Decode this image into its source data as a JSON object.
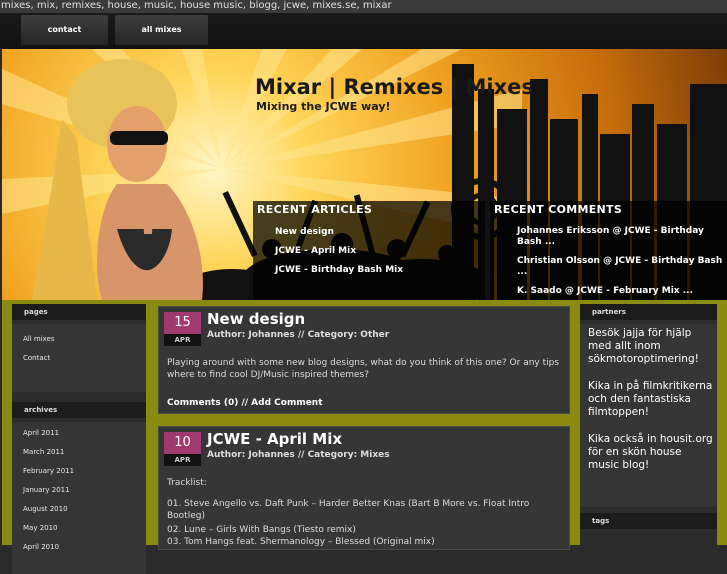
{
  "top_keywords": "mixes, mix, remixes, house, music, house music, blogg, jcwe, mixes.se, mixar",
  "nav": {
    "contact": "contact",
    "all_mixes": "all mixes"
  },
  "header": {
    "title": "Mixar | Remixes | Mixes",
    "subtitle": "Mixing the JCWE way!",
    "recent_articles_heading": "RECENT ARTICLES",
    "recent_articles": [
      "New design",
      "JCWE - April Mix",
      "JCWE - Birthday Bash Mix"
    ],
    "recent_comments_heading": "RECENT COMMENTS",
    "recent_comments": [
      "Johannes Eriksson @ JCWE - Birthday Bash ...",
      "Christian Olsson @ JCWE - Birthday Bash ...",
      "K. Saado @ JCWE - February Mix ..."
    ]
  },
  "sidebar_left": {
    "pages_heading": "pages",
    "pages": [
      "All mixes",
      "Contact"
    ],
    "archives_heading": "archives",
    "archives": [
      "April 2011",
      "March 2011",
      "February 2011",
      "January 2011",
      "August 2010",
      "May 2010",
      "April 2010"
    ]
  },
  "posts": [
    {
      "day": "15",
      "month": "APR",
      "title": "New design",
      "meta": "Author: Johannes  //  Category: Other",
      "body": "Playing around with some new blog designs, what do you think of this one? Or any tips where to find cool DJ/Music inspired themes?",
      "footer": "Comments (0)  //  Add Comment"
    },
    {
      "day": "10",
      "month": "APR",
      "title": "JCWE - April Mix",
      "meta": "Author: Johannes  //  Category: Mixes",
      "intro": "Tracklist:",
      "tracks": [
        "01. Steve Angello vs. Daft Punk – Harder Better Knas (Bart B More vs. Float Intro Bootleg)",
        "02. Lune – Girls With Bangs (Tiesto remix)",
        "03. Tom Hangs feat. Shermanology – Blessed (Original mix)"
      ]
    }
  ],
  "sidebar_right": {
    "partners_heading": "partners",
    "partners": [
      "Besök jajja för hjälp med allt inom sökmotoroptimering!",
      "Kika in på filmkritikerna och den fantastiska filmtoppen!",
      "Kika också in housit.org för en skön house music blog!"
    ],
    "tags_heading": "tags"
  },
  "colors": {
    "accent": "#a03a70",
    "frame": "#8a8a10",
    "header_orange": "#f0a321"
  }
}
